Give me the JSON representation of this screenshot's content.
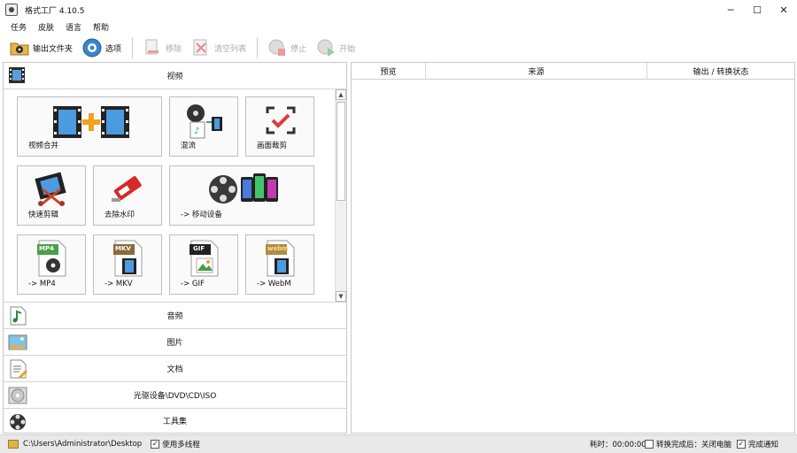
{
  "window": {
    "title": "格式工厂 4.10.5",
    "min": "─",
    "max": "☐",
    "close": "✕"
  },
  "menu": [
    "任务",
    "皮肤",
    "语言",
    "帮助"
  ],
  "toolbar": {
    "output_folder": "输出文件夹",
    "options": "选项",
    "remove": "移除",
    "clear_list": "清空列表",
    "stop": "停止",
    "start": "开始"
  },
  "video": {
    "header": "视频",
    "tiles": [
      {
        "label": "视频合并",
        "icon": "video-merge-icon"
      },
      {
        "label": "混流",
        "icon": "mux-icon"
      },
      {
        "label": "画面裁剪",
        "icon": "crop-icon"
      },
      {
        "label": "快速剪辑",
        "icon": "quick-clip-icon"
      },
      {
        "label": "去除水印",
        "icon": "remove-watermark-icon"
      },
      {
        "label": "-> 移动设备",
        "icon": "mobile-device-icon"
      },
      {
        "label": "-> MP4",
        "icon": "mp4-file-icon",
        "badge": "MP4"
      },
      {
        "label": "-> MKV",
        "icon": "mkv-file-icon",
        "badge": "MKV"
      },
      {
        "label": "-> GIF",
        "icon": "gif-file-icon",
        "badge": "GIF"
      },
      {
        "label": "-> WebM",
        "icon": "webm-file-icon",
        "badge": "webm"
      }
    ]
  },
  "categories": [
    {
      "label": "音频",
      "icon": "audio-icon"
    },
    {
      "label": "图片",
      "icon": "picture-icon"
    },
    {
      "label": "文档",
      "icon": "document-icon"
    },
    {
      "label": "光驱设备\\DVD\\CD\\ISO",
      "icon": "disc-icon"
    },
    {
      "label": "工具集",
      "icon": "toolbox-icon"
    }
  ],
  "task_table": {
    "columns": [
      "预览",
      "来源",
      "输出 / 转换状态"
    ]
  },
  "status": {
    "output_path": "C:\\Users\\Administrator\\Desktop",
    "multithread_label": "使用多线程",
    "multithread_checked": "✓",
    "elapsed": "耗时：00:00:00",
    "after_label": "转换完成后：关闭电脑",
    "after_checked": "",
    "notify_label": "完成通知",
    "notify_checked": "✓"
  }
}
